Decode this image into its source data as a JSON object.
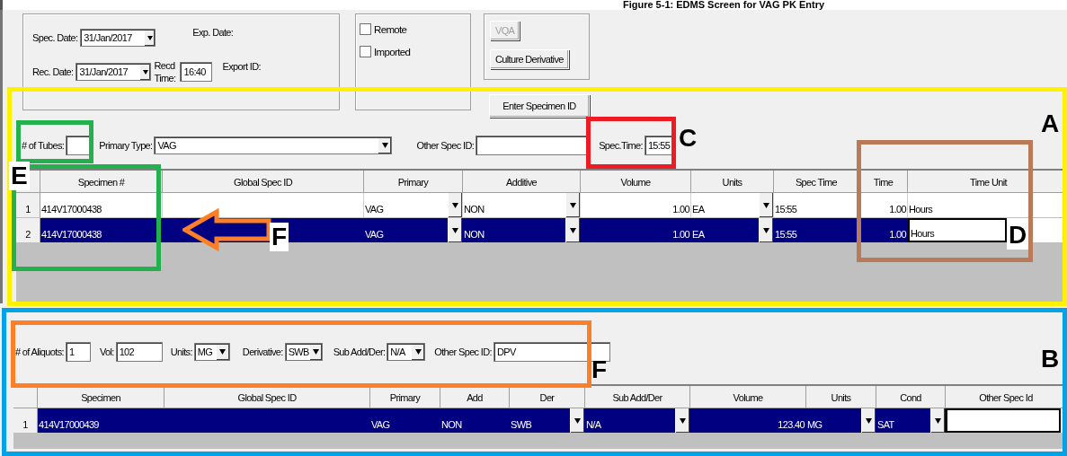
{
  "caption": "Figure 5-1: EDMS Screen for VAG PK Entry",
  "dates": {
    "spec_date": {
      "label": "Spec. Date:",
      "value": "31/Jan/2017"
    },
    "rec_date": {
      "label": "Rec. Date:",
      "value": "31/Jan/2017"
    },
    "recd_time": {
      "label": "Recd Time:",
      "value": "16:40"
    },
    "exp_date_label": "Exp. Date:",
    "export_id_label": "Export ID:"
  },
  "checkboxes": [
    {
      "label": "Remote",
      "checked": false
    },
    {
      "label": "Imported",
      "checked": false
    }
  ],
  "buttons": [
    {
      "label": "VQA",
      "disabled": true
    },
    {
      "label": "Culture Derivative",
      "disabled": false
    },
    {
      "label": "Enter Specimen ID",
      "disabled": false
    }
  ],
  "specimen_section": {
    "fields": [
      {
        "kind": "input",
        "label": "# of Tubes:"
      },
      {
        "kind": "dropdown",
        "label": "Primary Type:",
        "value": "VAG"
      },
      {
        "kind": "input",
        "label": "Other Spec ID:"
      },
      {
        "kind": "input",
        "label": "Spec.Time:",
        "value": "15:55"
      }
    ],
    "columns": [
      "Specimen #",
      "Global Spec ID",
      "Primary",
      "Additive",
      "Volume",
      "Units",
      "Spec Time",
      "Time",
      "Time Unit"
    ],
    "rows": [
      {
        "number": "1",
        "selected": false,
        "cells": [
          {
            "kind": "text",
            "text": "414V17000438"
          },
          {
            "kind": "text"
          },
          {
            "kind": "dropdown",
            "text": "VAG"
          },
          {
            "kind": "dropdown",
            "text": "NON"
          },
          {
            "kind": "number",
            "text": "1.00"
          },
          {
            "kind": "dropdown",
            "text": "EA"
          },
          {
            "kind": "text",
            "text": "15:55"
          },
          {
            "kind": "number",
            "text": "1.00"
          },
          {
            "kind": "text",
            "text": "Hours"
          }
        ]
      },
      {
        "number": "2",
        "selected": true,
        "cells": [
          {
            "kind": "text",
            "text": "414V17000438"
          },
          {
            "kind": "text"
          },
          {
            "kind": "dropdown",
            "text": "VAG"
          },
          {
            "kind": "dropdown",
            "text": "NON"
          },
          {
            "kind": "number",
            "text": "1.00"
          },
          {
            "kind": "dropdown",
            "text": "EA"
          },
          {
            "kind": "text",
            "text": "15:55"
          },
          {
            "kind": "number",
            "text": "1.00"
          },
          {
            "kind": "editing",
            "text": "Hours"
          }
        ]
      }
    ]
  },
  "aliquot_section": {
    "fields": [
      {
        "kind": "input",
        "label": "# of Aliquots:",
        "value": "1"
      },
      {
        "kind": "input",
        "label": "Vol:",
        "value": "102"
      },
      {
        "kind": "dropdown",
        "label": "Units:",
        "value": "MG"
      },
      {
        "kind": "dropdown",
        "label": "Derivative:",
        "value": "SWB"
      },
      {
        "kind": "dropdown",
        "label": "Sub Add/Der:",
        "value": "N/A"
      },
      {
        "kind": "input",
        "label": "Other Spec ID:",
        "value": "DPV"
      }
    ],
    "columns": [
      "Specimen",
      "Global Spec ID",
      "Primary",
      "Add",
      "Der",
      "Sub Add/Der",
      "Volume",
      "Units",
      "Cond",
      "Other Spec Id"
    ],
    "rows": [
      {
        "number": "1",
        "selected": true,
        "cells": [
          {
            "kind": "text",
            "text": "414V17000439"
          },
          {
            "kind": "text"
          },
          {
            "kind": "text",
            "text": "VAG"
          },
          {
            "kind": "text",
            "text": "NON"
          },
          {
            "kind": "dropdown",
            "text": "SWB"
          },
          {
            "kind": "dropdown",
            "text": "N/A"
          },
          {
            "kind": "number",
            "text": "123.40"
          },
          {
            "kind": "dropdown",
            "text": "MG"
          },
          {
            "kind": "dropdown",
            "text": "SAT"
          },
          {
            "kind": "editing"
          }
        ]
      }
    ]
  },
  "annotations": [
    {
      "label": "A",
      "color": "#fff200"
    },
    {
      "label": "B",
      "color": "#00a2e8"
    },
    {
      "label": "C",
      "color": "#ed1c24"
    },
    {
      "label": "D",
      "color": "#b97a57"
    },
    {
      "label": "E",
      "color": "#22b14c"
    },
    {
      "label": "F",
      "color": "#ff7f27"
    },
    {
      "label": "F",
      "color": "#ff7f27"
    }
  ]
}
